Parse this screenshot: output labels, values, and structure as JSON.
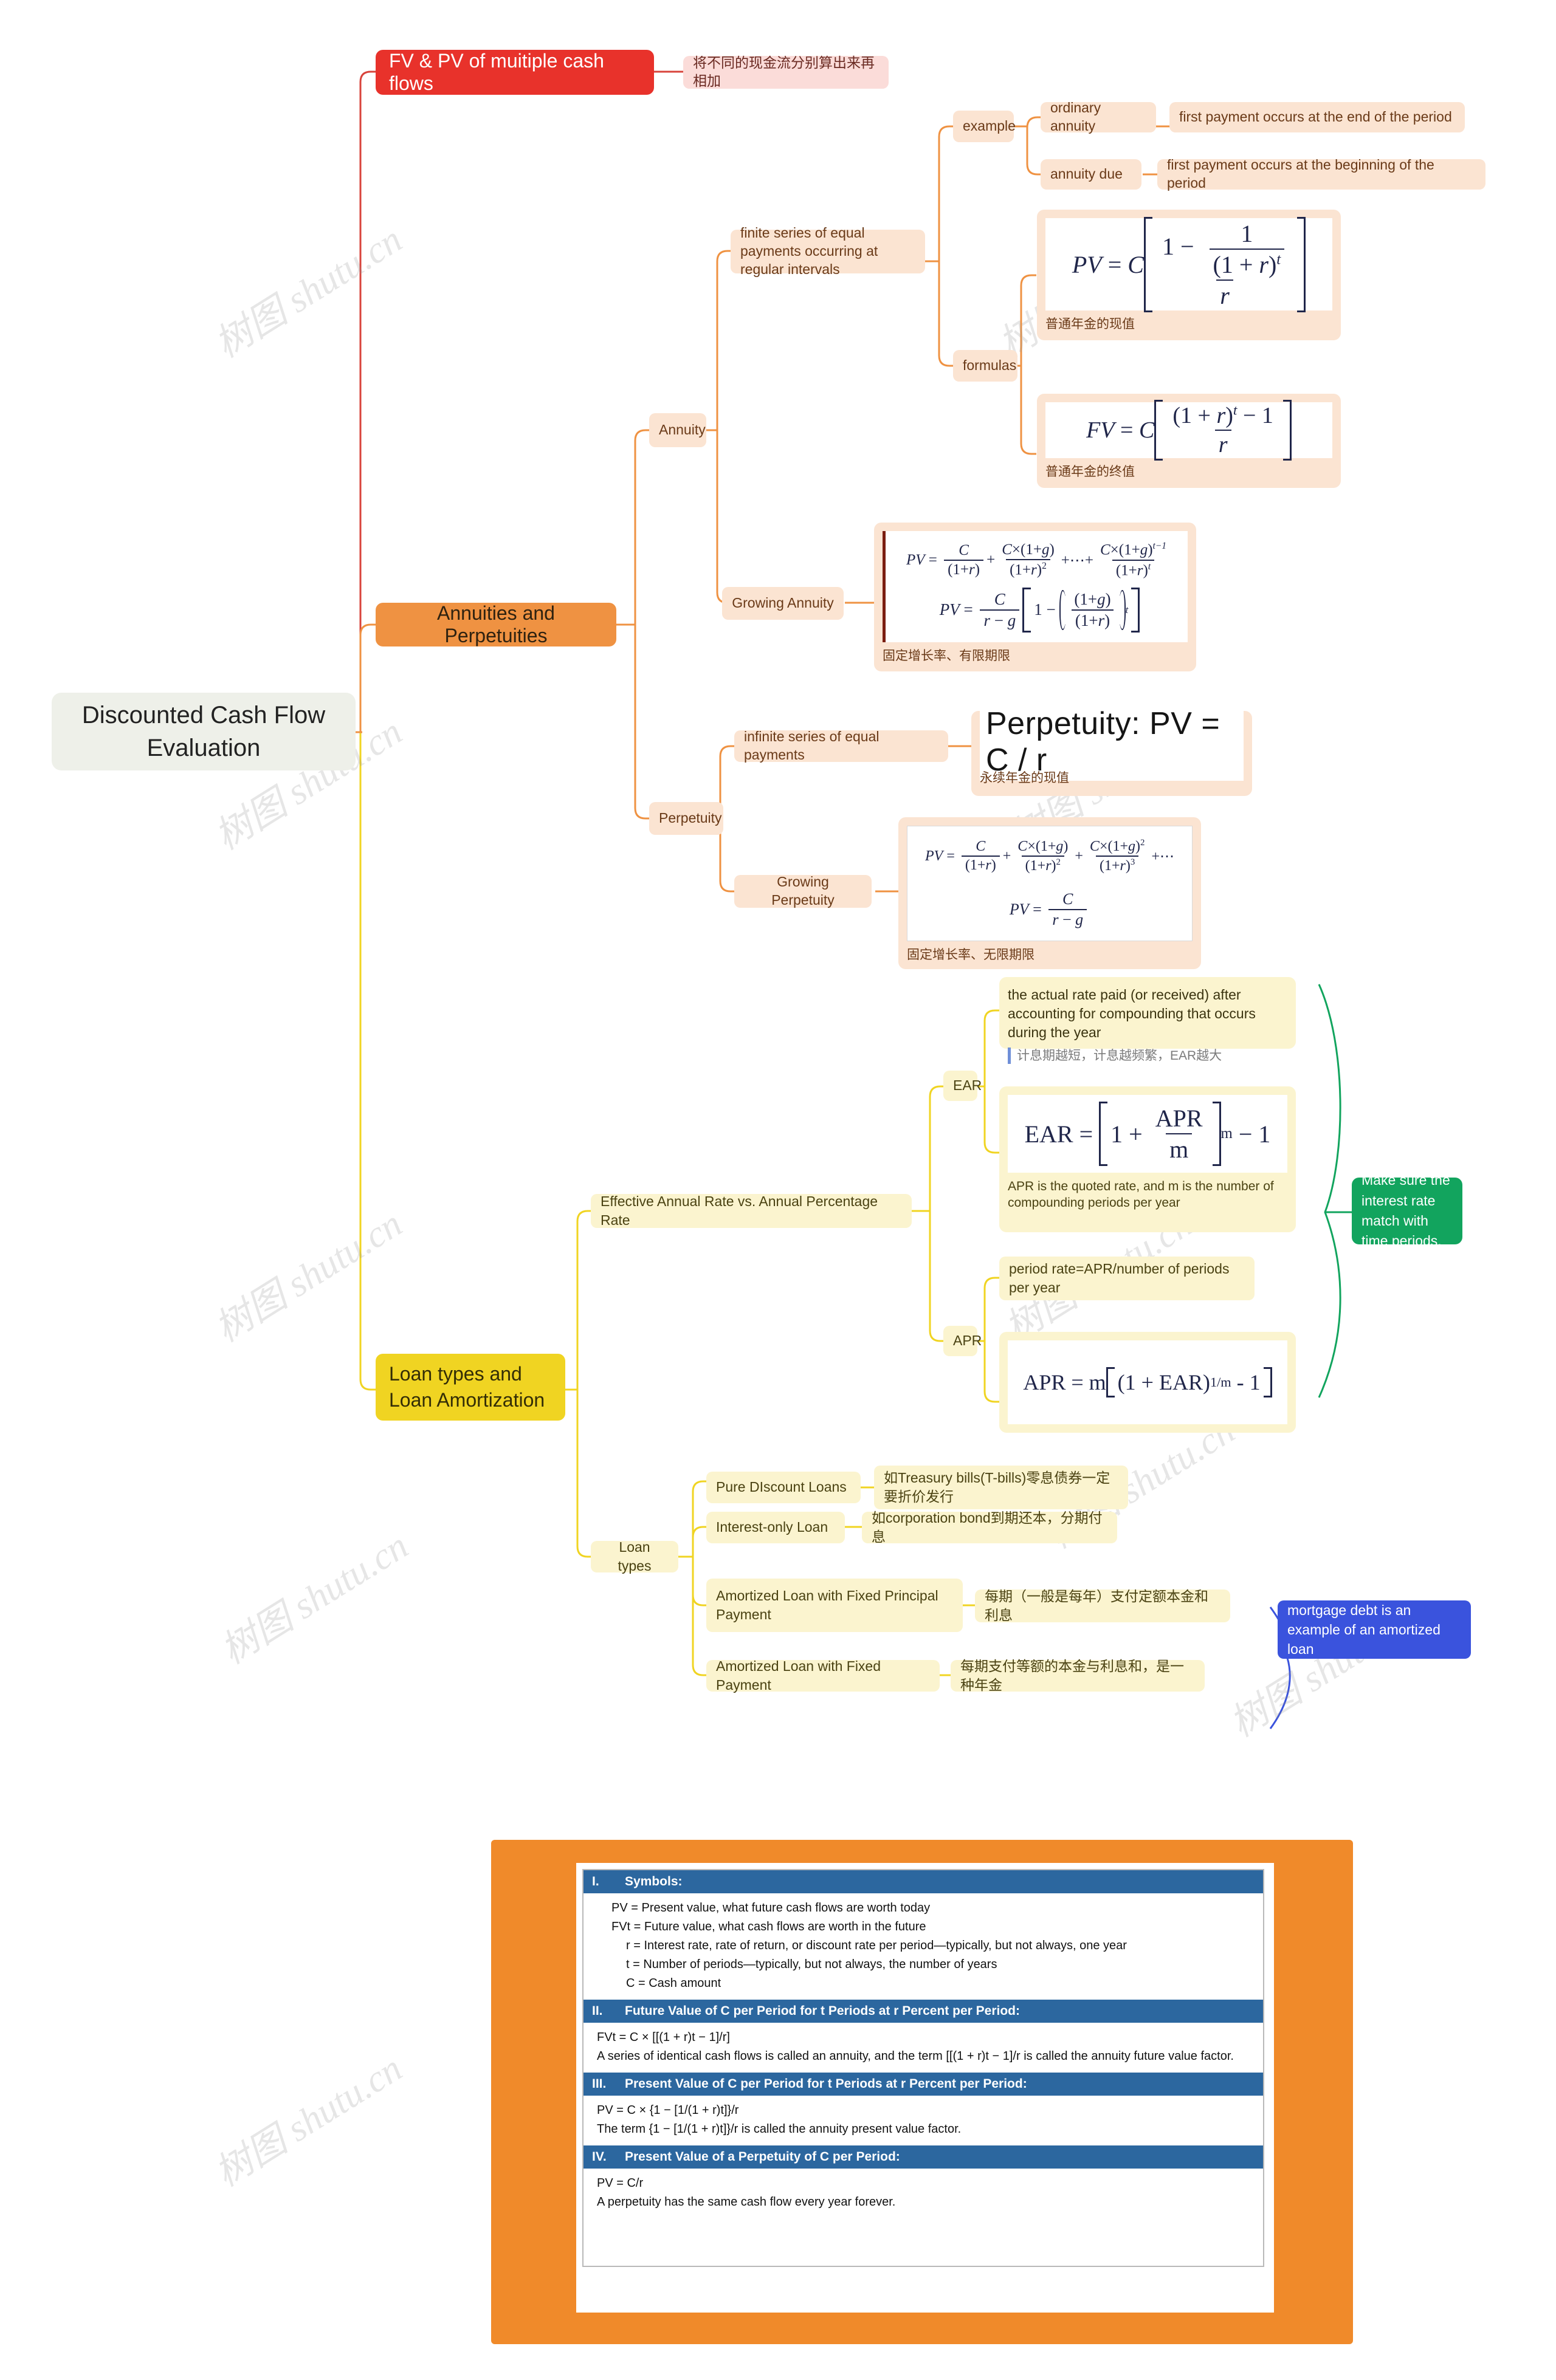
{
  "root": {
    "label": "Discounted Cash Flow Evaluation"
  },
  "branches": {
    "fvpv": {
      "label": "FV & PV of muitiple cash flows",
      "note": "将不同的现金流分别算出来再相加"
    },
    "annuities": {
      "label": "Annuities and Perpetuities",
      "annuity": {
        "label": "Annuity",
        "definition": "finite series of equal payments occurring at regular intervals",
        "example_label": "example",
        "examples": [
          {
            "name": "ordinary annuity",
            "desc": "first payment occurs at the end of the period"
          },
          {
            "name": "annuity due",
            "desc": "first payment occurs at the beginning of the period"
          }
        ],
        "formulas_label": "formulas",
        "pv_caption": "普通年金的现值",
        "fv_caption": "普通年金的终值"
      },
      "growing_annuity": {
        "label": "Growing Annuity",
        "caption": "固定增长率、有限期限"
      },
      "perpetuity": {
        "label": "Perpetuity",
        "definition": "infinite series of equal payments",
        "headline": "Perpetuity: PV = C / r",
        "caption": "永续年金的现值"
      },
      "growing_perpetuity": {
        "label": "Growing Perpetuity",
        "caption": "固定增长率、无限期限"
      }
    },
    "loans": {
      "label": "Loan types and\nLoan Amortization",
      "ear_vs_apr": {
        "label": "Effective Annual Rate vs. Annual Percentage Rate",
        "ear": {
          "label": "EAR",
          "definition": "the actual rate paid (or received) after accounting for compounding that occurs during the year",
          "note": "计息期越短，计息越频繁，EAR越大",
          "formula_caption": "APR is the quoted rate, and m is the number of compounding periods per year"
        },
        "apr": {
          "label": "APR",
          "definition": "period rate=APR/number of periods per year"
        },
        "callout": "Make sure the interest rate match with time periods."
      },
      "loan_types": {
        "label": "Loan types",
        "items": [
          {
            "name": "Pure DIscount Loans",
            "desc": "如Treasury bills(T-bills)零息债券一定要折价发行"
          },
          {
            "name": "Interest-only Loan",
            "desc": "如corporation bond到期还本，分期付息"
          },
          {
            "name": "Amortized Loan with Fixed Principal Payment",
            "desc": "每期（一般是每年）支付定额本金和利息"
          },
          {
            "name": "Amortized Loan with Fixed Payment",
            "desc": "每期支付等额的本金与利息和，是一种年金"
          }
        ],
        "callout": "mortgage debt is an example of an amortized loan"
      }
    }
  },
  "summary_table": {
    "sections": [
      {
        "numeral": "I.",
        "title": "Symbols:",
        "lines": [
          "PV = Present value, what future cash flows are worth today",
          "FVt = Future value, what cash flows are worth in the future",
          "r = Interest rate, rate of return, or discount rate per period—typically, but not always, one year",
          "t = Number of periods—typically, but not always, the number of years",
          "C = Cash amount"
        ]
      },
      {
        "numeral": "II.",
        "title": "Future Value of C per Period for t Periods at r Percent per Period:",
        "lines": [
          "FVt = C × [[(1 + r)t − 1]/r]",
          "A series of identical cash flows is called an annuity, and the term [[(1 + r)t − 1]/r is called the annuity future value factor."
        ]
      },
      {
        "numeral": "III.",
        "title": "Present Value of C per Period for t Periods at r Percent per Period:",
        "lines": [
          "PV = C × {1 − [1/(1 + r)t]}/r",
          "The term {1 − [1/(1 + r)t]}/r is called the annuity present value factor."
        ]
      },
      {
        "numeral": "IV.",
        "title": "Present Value of a Perpetuity of C per Period:",
        "lines": [
          "PV = C/r",
          "A perpetuity has the same cash flow every year forever."
        ]
      }
    ]
  },
  "watermark": {
    "text": "树图 shutu.cn"
  },
  "colors": {
    "root": "#eef0e9",
    "red": "#e8322b",
    "orange": "#ef9242",
    "yellow": "#f0d422",
    "peach": "#fbe4d2",
    "cream": "#fbf4cf",
    "green": "#12a45e",
    "blue": "#3a53dd",
    "panel_orange": "#f08a2a",
    "table_header": "#2c679f"
  }
}
